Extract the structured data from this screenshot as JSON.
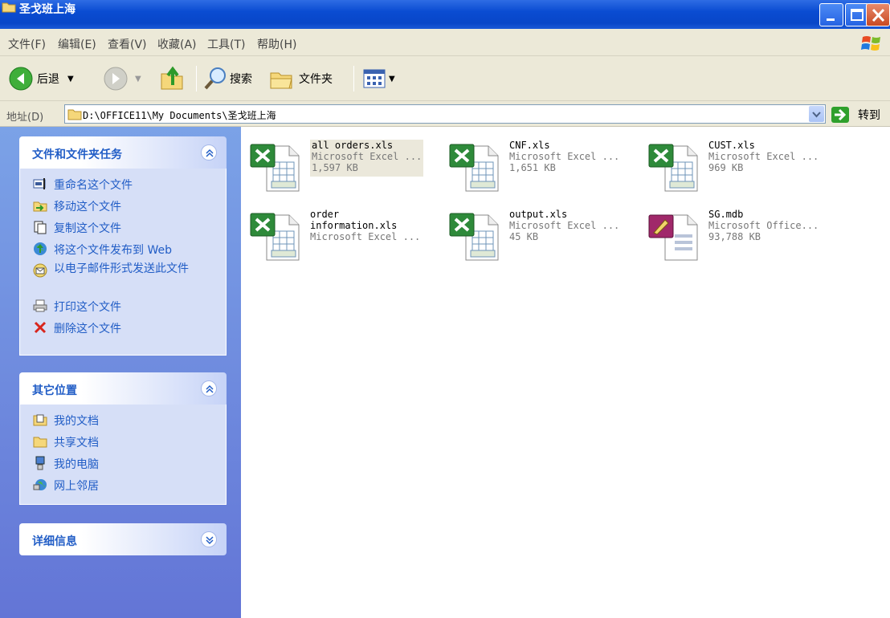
{
  "window": {
    "title": "圣戈班上海"
  },
  "menu": {
    "items": [
      "文件(F)",
      "编辑(E)",
      "查看(V)",
      "收藏(A)",
      "工具(T)",
      "帮助(H)"
    ]
  },
  "toolbar": {
    "back_label": "后退",
    "search_label": "搜索",
    "folders_label": "文件夹"
  },
  "address": {
    "label": "地址(D)",
    "path": "D:\\OFFICE11\\My Documents\\圣戈班上海",
    "go_label": "转到"
  },
  "tasks_panel": {
    "title": "文件和文件夹任务",
    "items": [
      {
        "label": "重命名这个文件",
        "icon": "rename-icon"
      },
      {
        "label": "移动这个文件",
        "icon": "move-icon"
      },
      {
        "label": "复制这个文件",
        "icon": "copy-icon"
      },
      {
        "label": "将这个文件发布到 Web",
        "icon": "publish-web-icon"
      },
      {
        "label": "以电子邮件形式发送此文件",
        "icon": "email-icon"
      },
      {
        "label": "打印这个文件",
        "icon": "print-icon"
      },
      {
        "label": "删除这个文件",
        "icon": "delete-icon"
      }
    ]
  },
  "places_panel": {
    "title": "其它位置",
    "items": [
      {
        "label": "我的文档",
        "icon": "my-documents-icon"
      },
      {
        "label": "共享文档",
        "icon": "shared-documents-icon"
      },
      {
        "label": "我的电脑",
        "icon": "my-computer-icon"
      },
      {
        "label": "网上邻居",
        "icon": "network-places-icon"
      }
    ]
  },
  "details_panel": {
    "title": "详细信息"
  },
  "files": [
    {
      "name": "all orders.xls",
      "line2": "Microsoft Excel ...",
      "line3": "1,597 KB",
      "type": "excel",
      "selected": true
    },
    {
      "name": "CNF.xls",
      "line2": "Microsoft Excel ...",
      "line3": "1,651 KB",
      "type": "excel",
      "selected": false
    },
    {
      "name": "CUST.xls",
      "line2": "Microsoft Excel ...",
      "line3": "969 KB",
      "type": "excel",
      "selected": false
    },
    {
      "name": "order",
      "line2": "information.xls",
      "line3": "Microsoft Excel ...",
      "type": "excel",
      "selected": false
    },
    {
      "name": "output.xls",
      "line2": "Microsoft Excel ...",
      "line3": "45 KB",
      "type": "excel",
      "selected": false
    },
    {
      "name": "SG.mdb",
      "line2": "Microsoft Office...",
      "line3": "93,788 KB",
      "type": "access",
      "selected": false
    }
  ]
}
